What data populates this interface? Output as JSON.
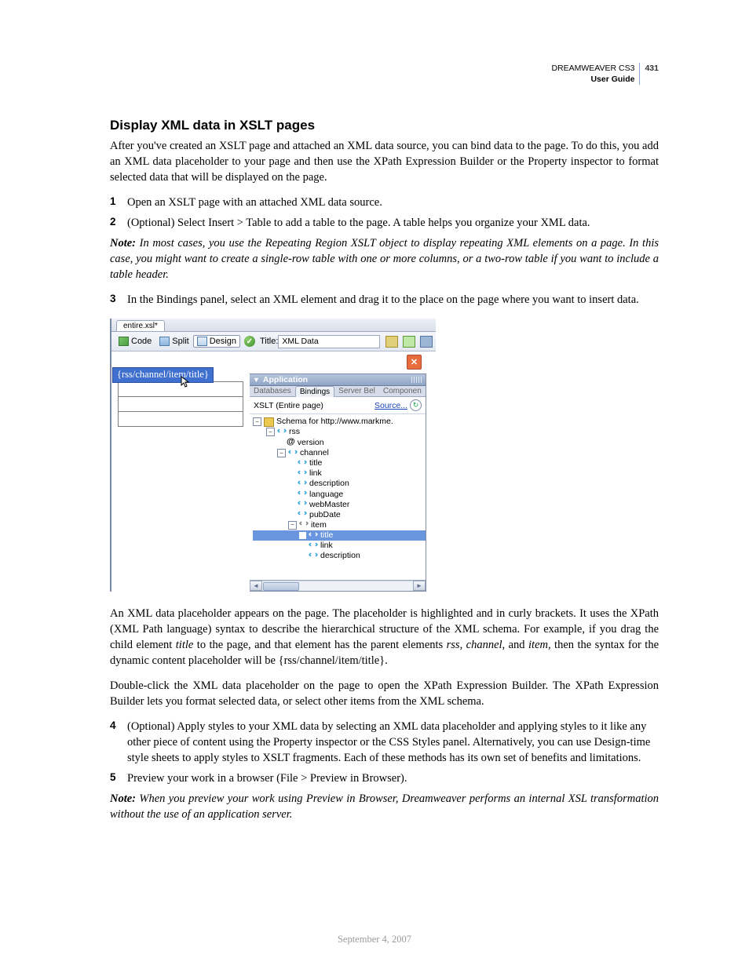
{
  "header": {
    "product": "DREAMWEAVER CS3",
    "guide": "User Guide",
    "page": "431"
  },
  "h2": "Display XML data in XSLT pages",
  "intro": "After you've created an XSLT page and attached an XML data source, you can bind data to the page. To do this, you add an XML data placeholder to your page and then use the XPath Expression Builder or the Property inspector to format selected data that will be displayed on the page.",
  "steps": {
    "s1": "Open an XSLT page with an attached XML data source.",
    "s2": "(Optional) Select Insert > Table to add a table to the page. A table helps you organize your XML data.",
    "s3": "In the Bindings panel, select an XML element and drag it to the place on the page where you want to insert data.",
    "s4": "(Optional) Apply styles to your XML data by selecting an XML data placeholder and applying styles to it like any other piece of content using the Property inspector or the CSS Styles panel. Alternatively, you can use Design-time style sheets to apply styles to XSLT fragments. Each of these methods has its own set of benefits and limitations.",
    "s5": "Preview your work in a browser (File > Preview in Browser)."
  },
  "note1_label": "Note:",
  "note1": "In most cases, you use the Repeating Region XSLT object to display repeating XML elements on a page. In this case, you might want to create a single-row table with one or more columns, or a two-row table if you want to include a table header.",
  "note2_label": "Note:",
  "note2": "When you preview your work using Preview in Browser, Dreamweaver performs an internal XSL transformation without the use of an application server.",
  "para_after_img_1a": "An XML data placeholder appears on the page. The placeholder is highlighted and in curly brackets. It uses the XPath (XML Path language) syntax to describe the hierarchical structure of the XML schema. For example, if you drag the child element ",
  "para_after_img_1b": " to the page, and that element has the parent elements ",
  "para_after_img_1c": ", and ",
  "para_after_img_1d": ", then the syntax for the dynamic content placeholder will be {rss/channel/item/title}.",
  "term_title": "title",
  "term_rss": "rss",
  "term_channel": "channel",
  "term_item": "item",
  "para_after_img_2": "Double-click the XML data placeholder on the page to open the XPath Expression Builder. The XPath Expression Builder lets you format selected data, or select other items from the XML schema.",
  "footer_date": "September 4, 2007",
  "app": {
    "doc_tab": "entire.xsl*",
    "btn_code": "Code",
    "btn_split": "Split",
    "btn_design": "Design",
    "title_label": "Title:",
    "title_value": "XML Data",
    "placeholder": "{rss/channel/item/title}",
    "panel": {
      "title": "Application",
      "tab_db": "Databases",
      "tab_bind": "Bindings",
      "tab_sb": "Server Bel",
      "tab_comp": "Componen",
      "sub_label": "XSLT (Entire page)",
      "source": "Source...",
      "schema_label": "Schema for http://www.markme.",
      "nodes": {
        "rss": "rss",
        "version": "version",
        "channel": "channel",
        "c_title": "title",
        "c_link": "link",
        "c_desc": "description",
        "c_lang": "language",
        "c_web": "webMaster",
        "c_pub": "pubDate",
        "item": "item",
        "i_title": "title",
        "i_link": "link",
        "i_desc": "description"
      }
    }
  }
}
